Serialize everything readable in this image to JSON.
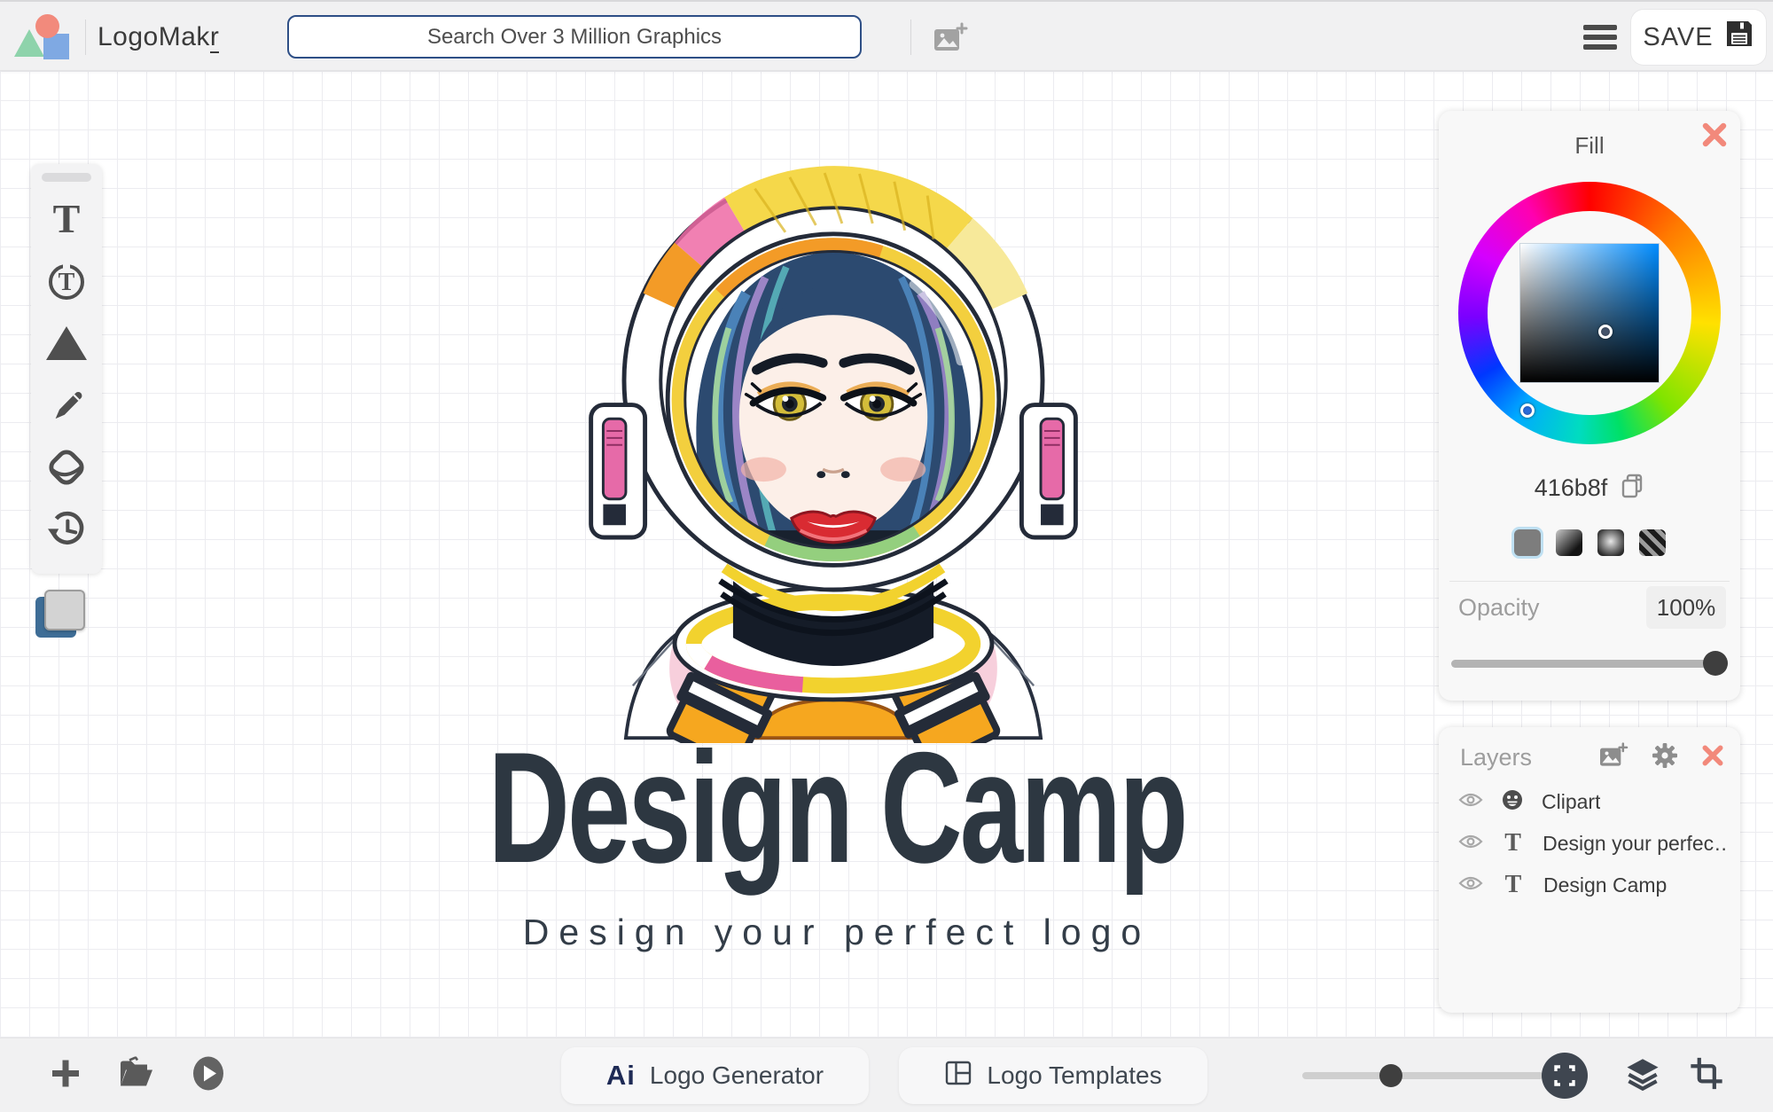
{
  "topbar": {
    "brand": {
      "name_head": "LogoMak",
      "name_tail": "r"
    },
    "search_placeholder": "Search Over 3 Million Graphics",
    "save_label": "SAVE"
  },
  "canvas": {
    "title": "Design Camp",
    "subtitle": "Design your perfect logo"
  },
  "fill_panel": {
    "title": "Fill",
    "hex_value": "416b8f",
    "opacity_label": "Opacity",
    "opacity_value": "100%"
  },
  "layers_panel": {
    "title": "Layers",
    "layers": [
      {
        "label": "Clipart"
      },
      {
        "label": "Design your perfec…"
      },
      {
        "label": "Design Camp"
      }
    ]
  },
  "bottombar": {
    "generator_badge": "Ai",
    "generator_label": "Logo Generator",
    "templates_label": "Logo Templates"
  },
  "colors": {
    "accent_fill": "#416b8f",
    "close_x": "#f2897b",
    "search_border": "#2e4f86"
  }
}
